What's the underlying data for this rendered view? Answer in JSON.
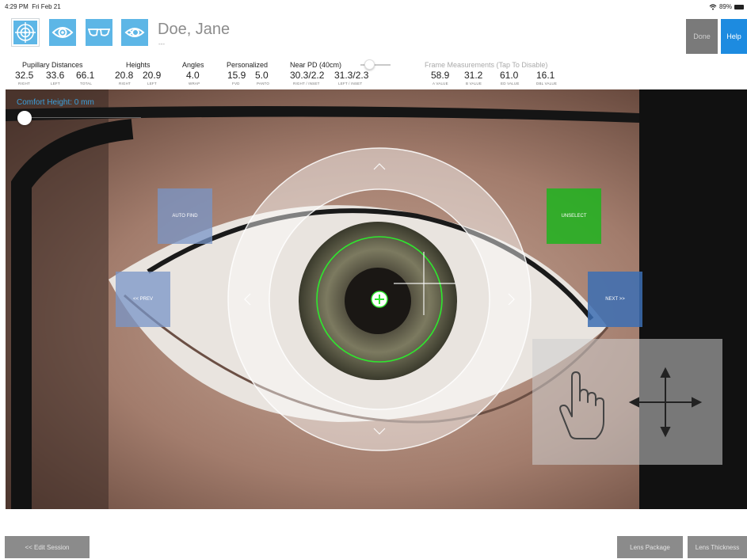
{
  "status": {
    "time": "4:29 PM",
    "date": "Fri Feb 21",
    "battery": "89%"
  },
  "header": {
    "patient_name": "Doe, Jane",
    "patient_sub": "---",
    "done_label": "Done",
    "help_label": "Help"
  },
  "measurements": {
    "pupillary": {
      "label": "Pupillary Distances",
      "right": "32.5",
      "left": "33.6",
      "total": "66.1",
      "right_sub": "RIGHT",
      "left_sub": "LEFT",
      "total_sub": "TOTAL"
    },
    "heights": {
      "label": "Heights",
      "right": "20.8",
      "left": "20.9",
      "right_sub": "RIGHT",
      "left_sub": "LEFT"
    },
    "angles": {
      "label": "Angles",
      "wrap": "4.0",
      "wrap_sub": "WRAP"
    },
    "personalized": {
      "label": "Personalized",
      "fvd": "15.9",
      "panto": "5.0",
      "fvd_sub": "FVD",
      "panto_sub": "PANTO"
    },
    "near_pd": {
      "label": "Near PD (40cm)",
      "right": "30.3/2.2",
      "left": "31.3/2.3",
      "right_sub": "RIGHT / INSET",
      "left_sub": "LEFT / INSET"
    },
    "frame": {
      "label": "Frame Measurements (Tap To Disable)",
      "a": "58.9",
      "b": "31.2",
      "ed": "61.0",
      "dbl": "16.1",
      "a_sub": "A VALUE",
      "b_sub": "B VALUE",
      "ed_sub": "ED VALUE",
      "dbl_sub": "DBL VALUE"
    }
  },
  "comfort": {
    "label": "Comfort Height: 0 mm"
  },
  "photo_buttons": {
    "autofind": "AUTO FIND",
    "prev": "<< PREV",
    "unselect": "UNSELECT",
    "next": "NEXT >>"
  },
  "bottom": {
    "edit_session": "<< Edit Session",
    "lens_package": "Lens Package",
    "lens_thickness": "Lens Thickness"
  },
  "colors": {
    "accent": "#5db6e6",
    "help": "#1d8be0",
    "unselect": "#1eb41e",
    "comfort_text": "#3b9ed9"
  },
  "icons": [
    "target-icon",
    "eye-icon",
    "glasses-icon",
    "eye-cycle-icon",
    "wifi-icon",
    "battery-icon",
    "hand-pointer-icon",
    "move-arrows-icon",
    "chevron-up-icon",
    "chevron-down-icon",
    "chevron-left-icon",
    "chevron-right-icon"
  ]
}
